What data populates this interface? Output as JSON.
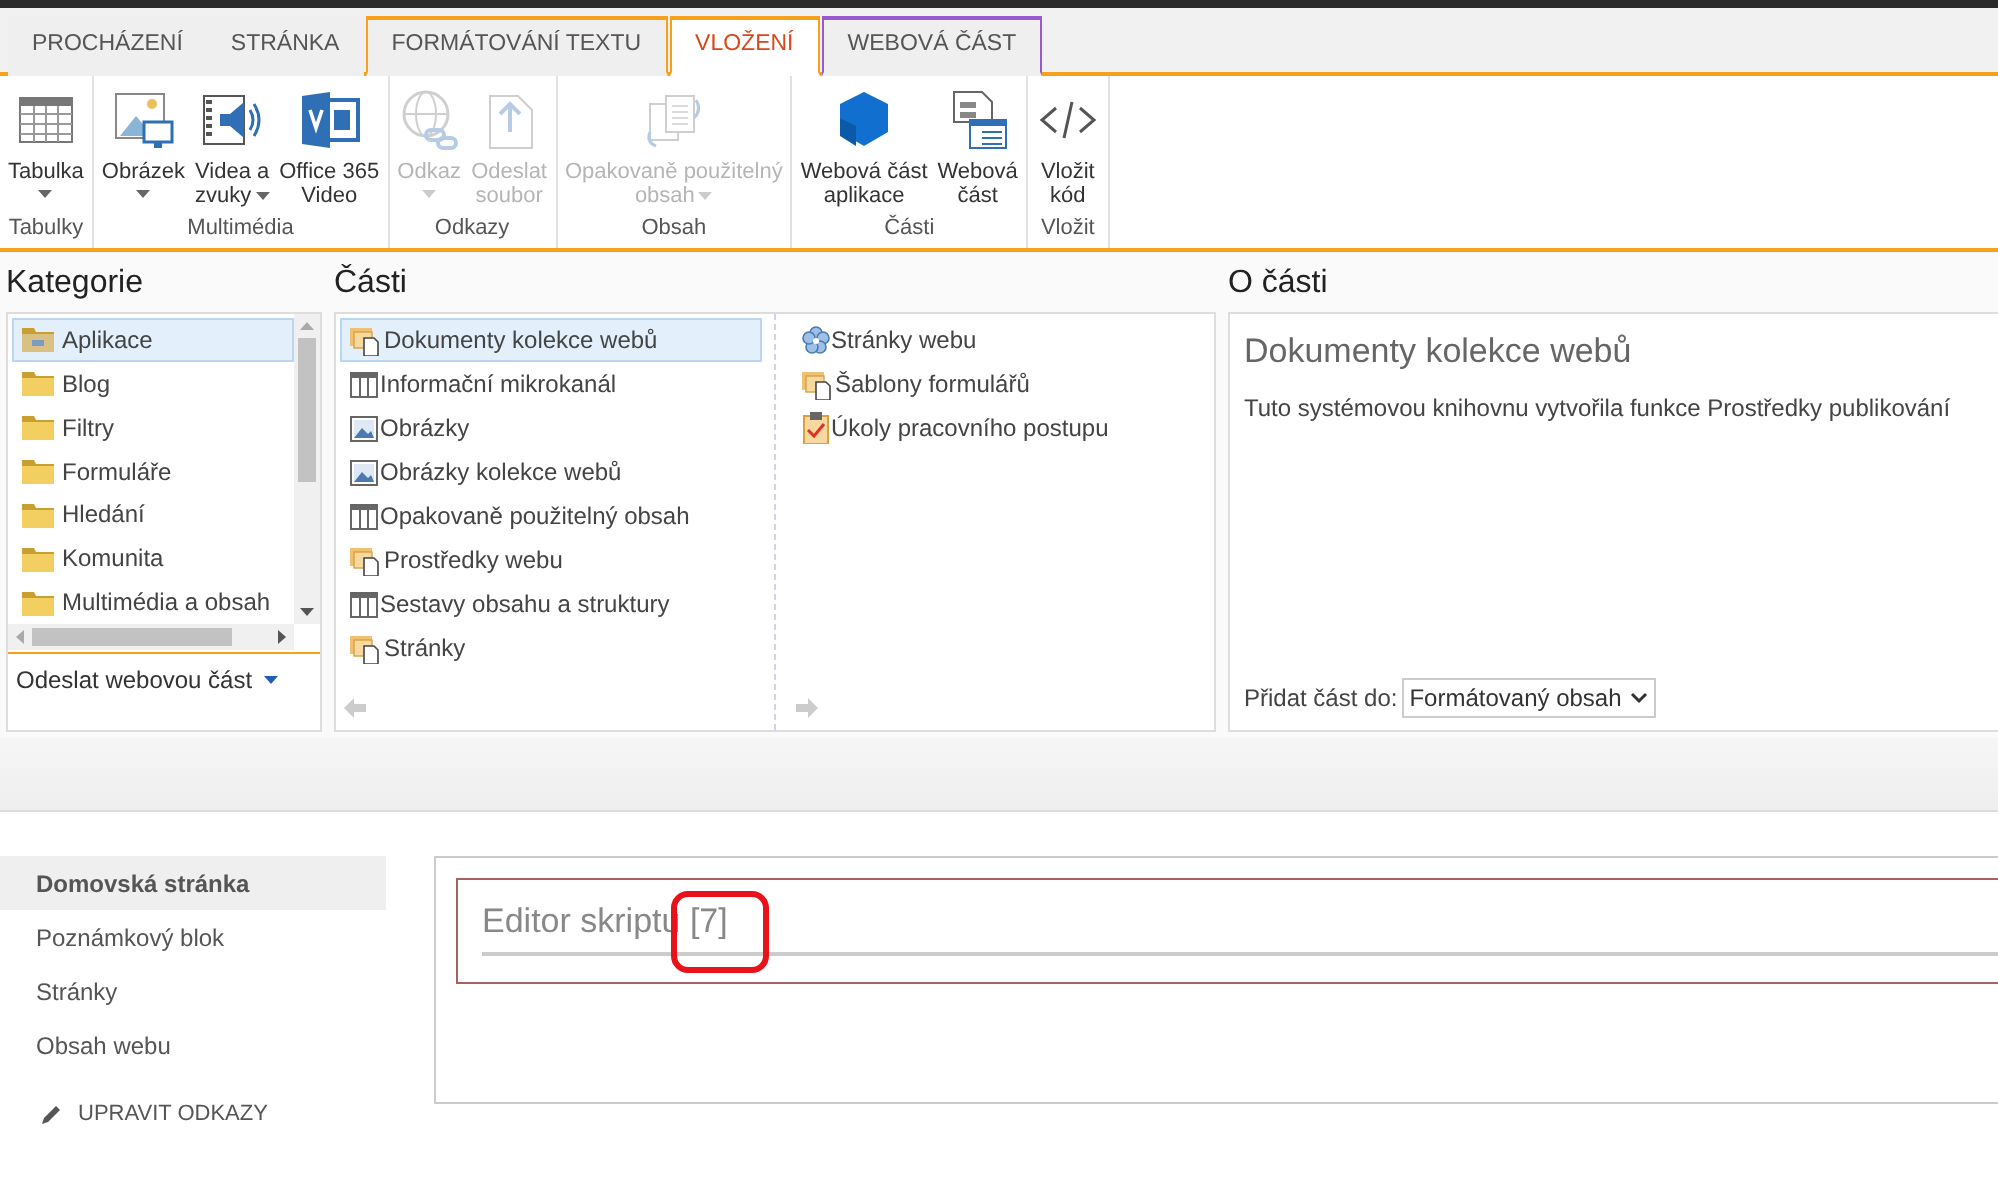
{
  "ribbon": {
    "tabs": [
      {
        "label": "PROCHÁZENÍ",
        "selected": false,
        "kind": "plain"
      },
      {
        "label": "STRÁNKA",
        "selected": false,
        "kind": "plain"
      },
      {
        "label": "FORMÁTOVÁNÍ TEXTU",
        "selected": false,
        "kind": "context",
        "color": "#f7a11a"
      },
      {
        "label": "VLOŽENÍ",
        "selected": true,
        "kind": "context",
        "color": "#f7a11a"
      },
      {
        "label": "WEBOVÁ ČÁST",
        "selected": false,
        "kind": "context",
        "color": "#9b59d0"
      }
    ],
    "groups": [
      {
        "label": "Tabulky",
        "buttons": [
          {
            "lines": [
              "Tabulka"
            ],
            "dropdown": true,
            "disabled": false
          }
        ]
      },
      {
        "label": "Multimédia",
        "buttons": [
          {
            "lines": [
              "Obrázek"
            ],
            "dropdown": true,
            "disabled": false
          },
          {
            "lines": [
              "Videa a",
              "zvuky"
            ],
            "dropdown": true,
            "disabled": false
          },
          {
            "lines": [
              "Office 365",
              "Video"
            ],
            "dropdown": false,
            "disabled": false
          }
        ]
      },
      {
        "label": "Odkazy",
        "buttons": [
          {
            "lines": [
              "Odkaz"
            ],
            "dropdown": true,
            "disabled": true
          },
          {
            "lines": [
              "Odeslat",
              "soubor"
            ],
            "dropdown": false,
            "disabled": true
          }
        ]
      },
      {
        "label": "Obsah",
        "buttons": [
          {
            "lines": [
              "Opakovaně použitelný",
              "obsah"
            ],
            "dropdown": true,
            "disabled": true
          }
        ]
      },
      {
        "label": "Části",
        "buttons": [
          {
            "lines": [
              "Webová část",
              "aplikace"
            ],
            "dropdown": false,
            "disabled": false
          },
          {
            "lines": [
              "Webová",
              "část"
            ],
            "dropdown": false,
            "disabled": false
          }
        ]
      },
      {
        "label": "Vložit",
        "buttons": [
          {
            "lines": [
              "Vložit",
              "kód"
            ],
            "dropdown": false,
            "disabled": false
          }
        ]
      }
    ]
  },
  "categories": {
    "title": "Kategorie",
    "items": [
      {
        "label": "Aplikace",
        "selected": true
      },
      {
        "label": "Blog",
        "selected": false
      },
      {
        "label": "Filtry",
        "selected": false
      },
      {
        "label": "Formuláře",
        "selected": false
      },
      {
        "label": "Hledání",
        "selected": false
      },
      {
        "label": "Komunita",
        "selected": false
      },
      {
        "label": "Multimédia a obsah",
        "selected": false
      }
    ],
    "upload_link": "Odeslat webovou část"
  },
  "parts": {
    "title": "Části",
    "columns": [
      [
        {
          "label": "Dokumenty kolekce webů",
          "selected": true,
          "kind": "library"
        },
        {
          "label": "Informační mikrokanál",
          "selected": false,
          "kind": "list"
        },
        {
          "label": "Obrázky",
          "selected": false,
          "kind": "image"
        },
        {
          "label": "Obrázky kolekce webů",
          "selected": false,
          "kind": "image"
        },
        {
          "label": "Opakovaně použitelný obsah",
          "selected": false,
          "kind": "list"
        },
        {
          "label": "Prostředky webu",
          "selected": false,
          "kind": "library"
        },
        {
          "label": "Sestavy obsahu a struktury",
          "selected": false,
          "kind": "list"
        },
        {
          "label": "Stránky",
          "selected": false,
          "kind": "library"
        }
      ],
      [
        {
          "label": "Stránky webu",
          "selected": false,
          "kind": "site"
        },
        {
          "label": "Šablony formulářů",
          "selected": false,
          "kind": "library"
        },
        {
          "label": "Úkoly pracovního postupu",
          "selected": false,
          "kind": "tasks"
        }
      ]
    ]
  },
  "about": {
    "title": "O části",
    "part_title": "Dokumenty kolekce webů",
    "description": "Tuto systémovou knihovnu vytvořila funkce Prostředky publikování",
    "add_to_label": "Přidat část do:",
    "add_to_value": "Formátovaný obsah"
  },
  "nav": {
    "items": [
      {
        "label": "Domovská stránka",
        "selected": true
      },
      {
        "label": "Poznámkový blok",
        "selected": false
      },
      {
        "label": "Stránky",
        "selected": false
      },
      {
        "label": "Obsah webu",
        "selected": false
      }
    ],
    "edit_links": "UPRAVIT ODKAZY"
  },
  "webpart": {
    "title": "Editor skriptu",
    "marker": "[7]",
    "highlighted": true
  }
}
